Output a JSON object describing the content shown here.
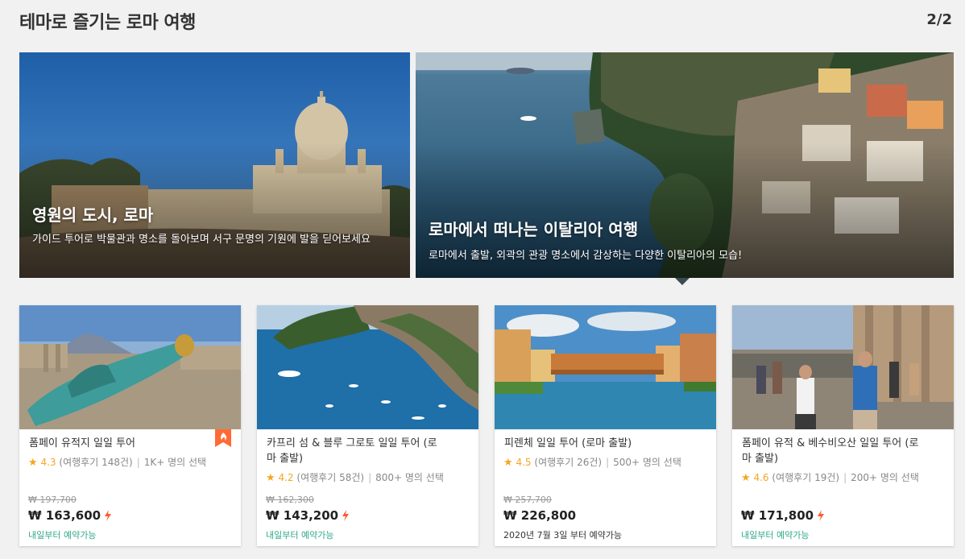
{
  "header": {
    "title": "테마로 즐기는 로마 여행",
    "pager": "2/2"
  },
  "themes": [
    {
      "title": "영원의 도시, 로마",
      "description": "가이드 투어로 박물관과 명소를 돌아보며 서구 문명의 기원에 발을 딛어보세요"
    },
    {
      "title": "로마에서 떠나는 이탈리아 여행",
      "description": "로마에서 출발, 외곽의 관광 명소에서 감상하는 다양한 이탈리아의 모습!"
    }
  ],
  "tours": [
    {
      "name": "폼페이 유적지 일일 투어",
      "score": "4.3",
      "reviews": "(여행후기 148건)",
      "selected": "1K+ 명의 선택",
      "old_price": "₩ 197,700",
      "price": "₩ 163,600",
      "availability": "내일부터 예약가능"
    },
    {
      "name": "카프리 섬 & 블루 그로토 일일 투어 (로마 출발)",
      "score": "4.2",
      "reviews": "(여행후기 58건)",
      "selected": "800+ 명의 선택",
      "old_price": "₩ 162,300",
      "price": "₩ 143,200",
      "availability": "내일부터 예약가능"
    },
    {
      "name": "피렌체 일일 투어 (로마 출발)",
      "score": "4.5",
      "reviews": "(여행후기 26건)",
      "selected": "500+ 명의 선택",
      "old_price": "₩ 257,700",
      "price": "₩ 226,800",
      "availability": "2020년 7월 3일 부터 예약가능"
    },
    {
      "name": "폼페이 유적 & 베수비오산 일일 투어 (로마 출발)",
      "score": "4.6",
      "reviews": "(여행후기 19건)",
      "selected": "200+ 명의 선택",
      "price": "₩ 171,800",
      "availability": "내일부터 예약가능"
    }
  ],
  "icons": {
    "star": "star-icon",
    "bolt": "lightning-bolt-icon",
    "badge": "hot-deal-badge-icon"
  },
  "colors": {
    "star": "#f5a623",
    "bolt": "#ff5a2b",
    "availability": "#2ea88a",
    "badge": "#ff6b35"
  }
}
